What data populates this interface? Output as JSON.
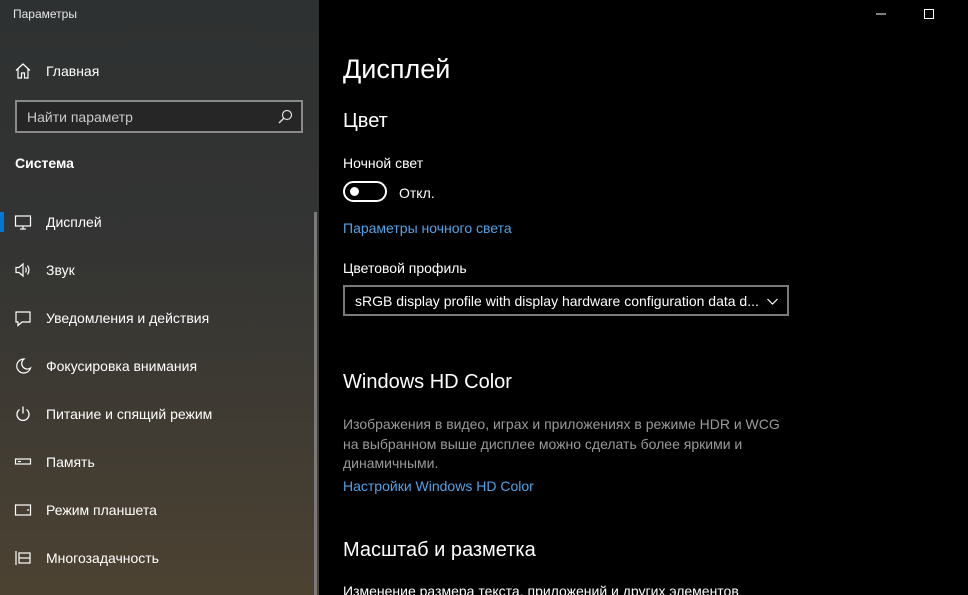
{
  "window": {
    "title": "Параметры",
    "minimize_icon": "minimize-icon",
    "maximize_icon": "maximize-icon"
  },
  "sidebar": {
    "home": {
      "label": "Главная",
      "icon": "home-icon"
    },
    "search": {
      "placeholder": "Найти параметр",
      "value": "",
      "icon": "search-icon"
    },
    "section_title": "Система",
    "items": [
      {
        "label": "Дисплей",
        "icon": "monitor-icon",
        "selected": true
      },
      {
        "label": "Звук",
        "icon": "speaker-icon"
      },
      {
        "label": "Уведомления и действия",
        "icon": "notification-icon"
      },
      {
        "label": "Фокусировка внимания",
        "icon": "moon-icon"
      },
      {
        "label": "Питание и спящий режим",
        "icon": "power-icon"
      },
      {
        "label": "Память",
        "icon": "storage-icon"
      },
      {
        "label": "Режим планшета",
        "icon": "tablet-icon"
      },
      {
        "label": "Многозадачность",
        "icon": "multitasking-icon"
      }
    ],
    "accent_color": "#0078d7"
  },
  "main": {
    "page_title": "Дисплей",
    "color_section": {
      "heading": "Цвет",
      "night_light_label": "Ночной свет",
      "night_light_state": "Откл.",
      "night_light_on": false,
      "night_light_link": "Параметры ночного света",
      "color_profile_label": "Цветовой профиль",
      "color_profile_value": "sRGB display profile with display hardware configuration data d..."
    },
    "hd_color_section": {
      "heading": "Windows HD Color",
      "description": "Изображения в видео, играх и приложениях в режиме HDR и WCG на выбранном выше дисплее можно сделать более яркими и динамичными.",
      "link": "Настройки Windows HD Color"
    },
    "scale_section": {
      "heading": "Масштаб и разметка",
      "description": "Изменение размера текста, приложений и других элементов"
    },
    "link_color": "#4fa3e8"
  }
}
